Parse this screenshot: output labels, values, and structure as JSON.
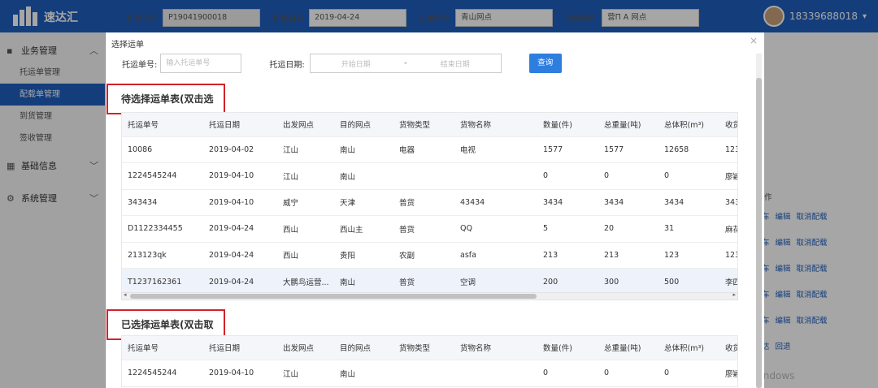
{
  "app": {
    "logo_text": "速达汇",
    "user_name": "18339688018"
  },
  "sidebar": {
    "groups": [
      {
        "label": "业务管理",
        "items": [
          "托运单管理",
          "配载单管理",
          "到货管理",
          "签收管理"
        ],
        "active": "配载单管理"
      },
      {
        "label": "基础信息"
      },
      {
        "label": "系统管理"
      }
    ]
  },
  "bg_filter": {
    "loading_no_label": "配载单号",
    "loading_no": "P19041900018",
    "loading_date_label": "配载日期",
    "loading_date": "2019-04-24",
    "depart_label": "出发网点",
    "depart": "青山网点",
    "dest_label": "目的网点",
    "dest": "营П A 网点"
  },
  "bg_actions": {
    "header": "作",
    "rows": [
      [
        "车",
        "编辑",
        "取消配载"
      ],
      [
        "车",
        "编辑",
        "取消配载"
      ],
      [
        "车",
        "编辑",
        "取消配载"
      ],
      [
        "车",
        "编辑",
        "取消配载"
      ],
      [
        "车",
        "编辑",
        "取消配载"
      ],
      [
        "达",
        "回退"
      ]
    ]
  },
  "watermark": "激活 Windows",
  "modal": {
    "title": "选择运单",
    "close": "×",
    "search": {
      "waybill_label": "托运单号:",
      "waybill_placeholder": "输入托运单号",
      "date_label": "托运日期:",
      "start_placeholder": "开始日期",
      "dash": "-",
      "end_placeholder": "结束日期",
      "query_button": "查询"
    },
    "pending_title": "待选择运单表(双击选择)",
    "selected_title": "已选择运单表(双击取消)",
    "columns": [
      "托运单号",
      "托运日期",
      "出发网点",
      "目的网点",
      "货物类型",
      "货物名称",
      "数量(件)",
      "总重量(吨)",
      "总体积(m³)",
      "收货"
    ],
    "pending_rows": [
      [
        "10086",
        "2019-04-02",
        "江山",
        "南山",
        "电器",
        "电视",
        "1577",
        "1577",
        "12658",
        "123"
      ],
      [
        "1224545244",
        "2019-04-10",
        "江山",
        "南山",
        "",
        "",
        "0",
        "0",
        "0",
        "廖颖"
      ],
      [
        "343434",
        "2019-04-10",
        "威宁",
        "天津",
        "普货",
        "43434",
        "3434",
        "3434",
        "3434",
        "343"
      ],
      [
        "D1122334455",
        "2019-04-24",
        "西山",
        "西山主",
        "普货",
        "QQ",
        "5",
        "20",
        "31",
        "麻花"
      ],
      [
        "213123qk",
        "2019-04-24",
        "西山",
        "贵阳",
        "农副",
        "asfa",
        "213",
        "213",
        "123",
        "123"
      ],
      [
        "T1237162361",
        "2019-04-24",
        "大鹏鸟运营...",
        "南山",
        "普货",
        "空调",
        "200",
        "300",
        "500",
        "李四"
      ]
    ],
    "selected_rows": [
      [
        "1224545244",
        "2019-04-10",
        "江山",
        "南山",
        "",
        "",
        "0",
        "0",
        "0",
        "廖颖"
      ]
    ]
  }
}
